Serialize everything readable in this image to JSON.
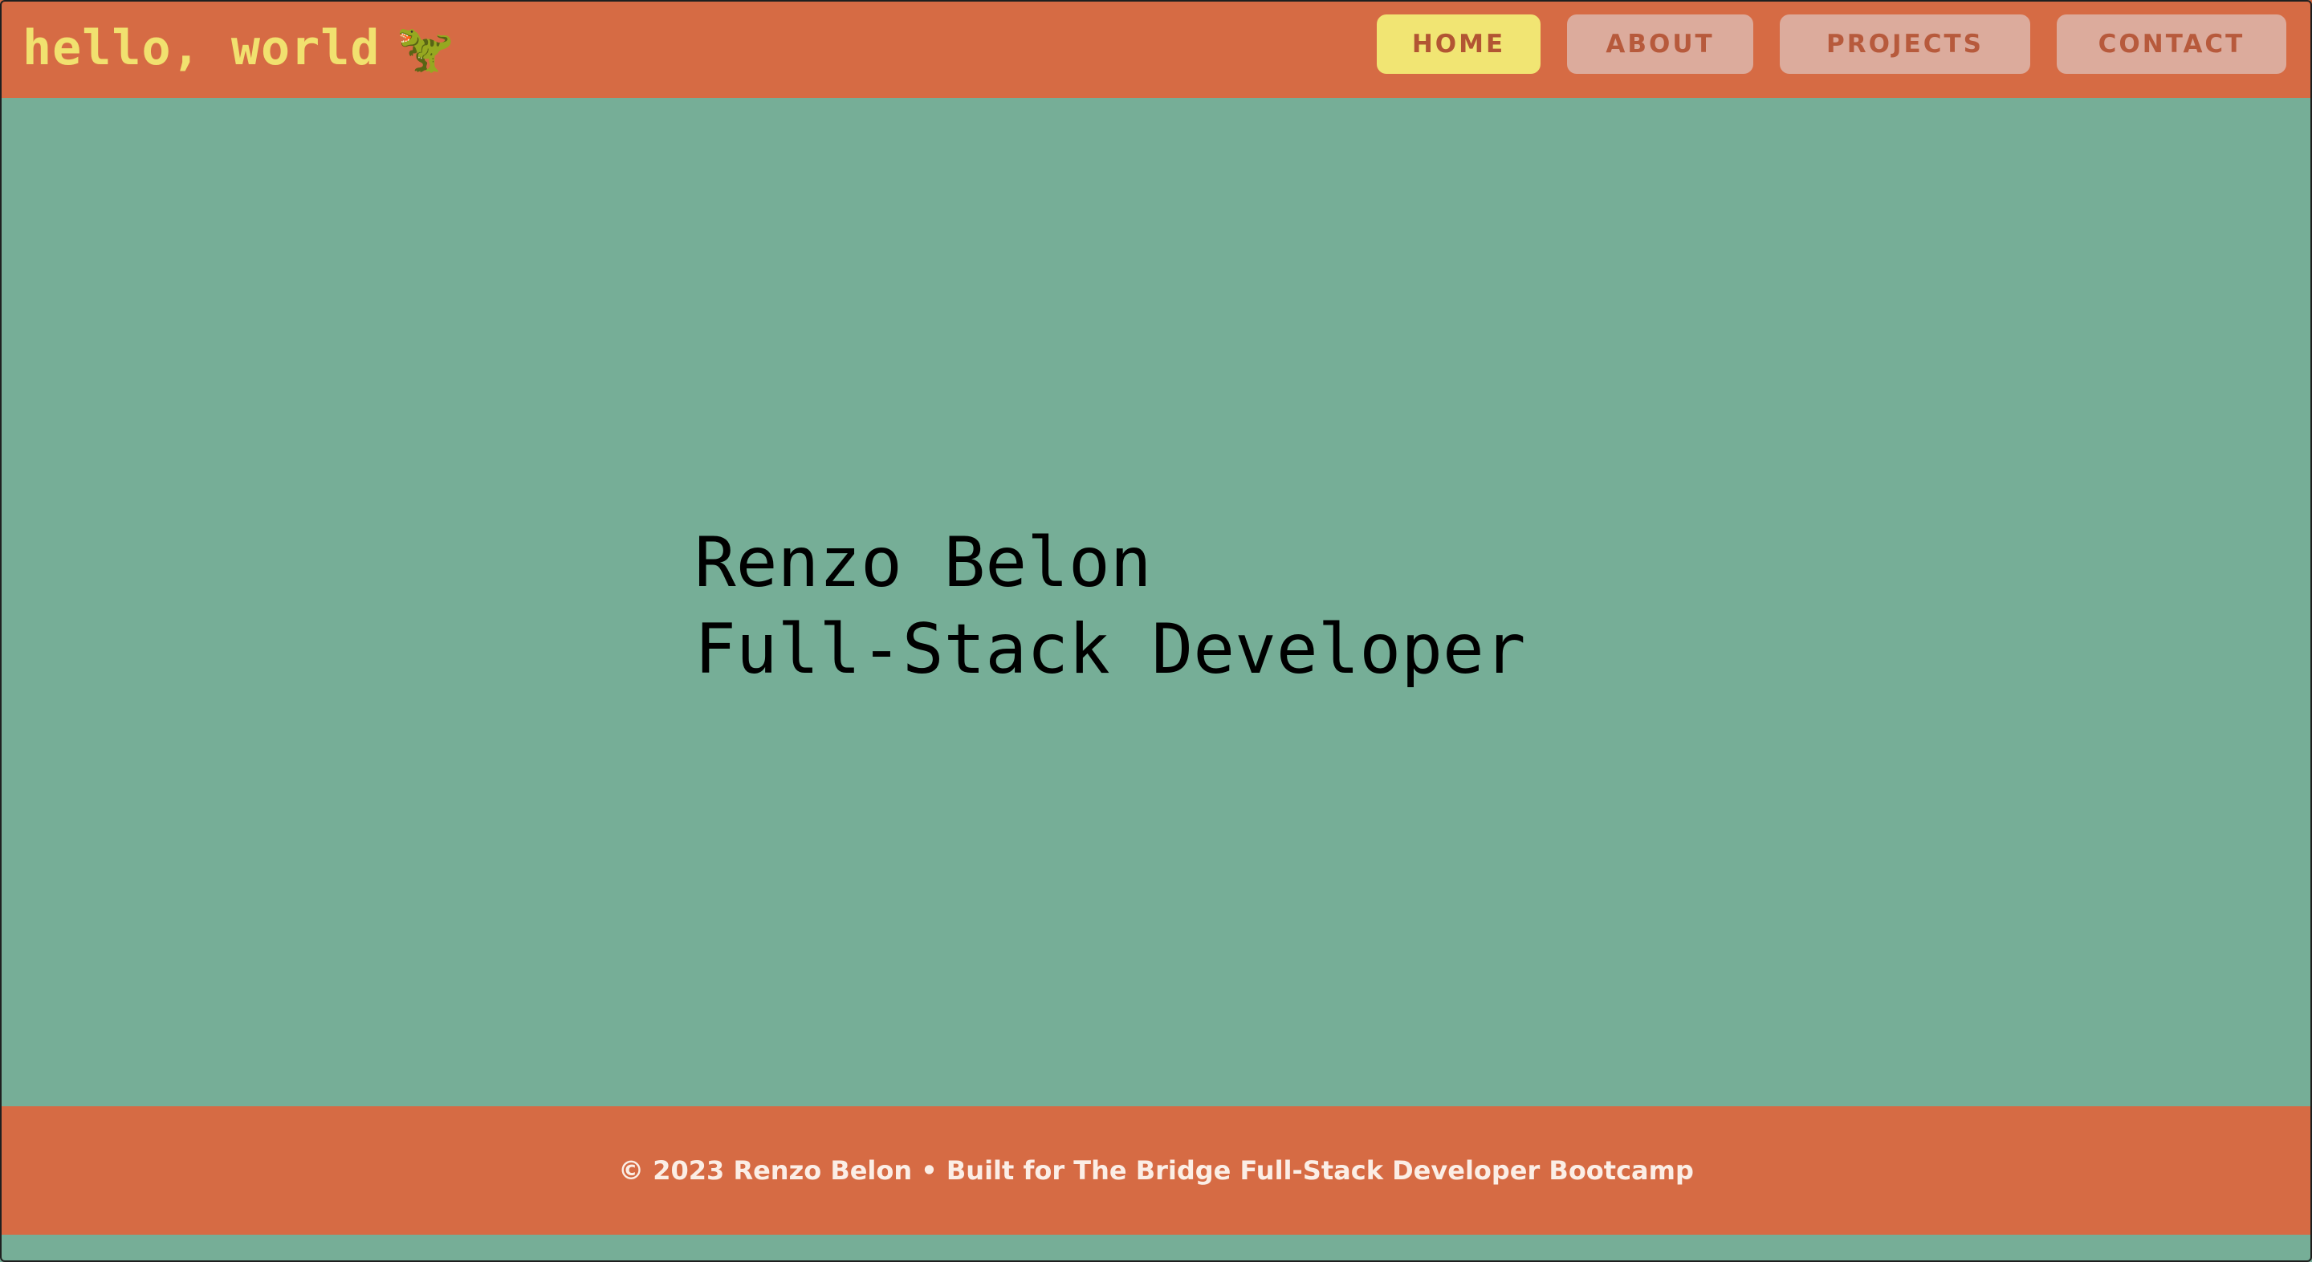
{
  "header": {
    "logo_text": "hello, world",
    "logo_icon": "🦖"
  },
  "nav": {
    "items": [
      {
        "label": "HOME",
        "active": true
      },
      {
        "label": "ABOUT",
        "active": false
      },
      {
        "label": "PROJECTS",
        "active": false
      },
      {
        "label": "CONTACT",
        "active": false
      }
    ]
  },
  "hero": {
    "name": "Renzo Belon",
    "role": "Full-Stack Developer"
  },
  "footer": {
    "text": "© 2023 Renzo Belon • Built for The Bridge Full-Stack Developer Bootcamp"
  },
  "colors": {
    "background": "#76ae97",
    "header_footer": "#d66b44",
    "accent_yellow": "#f1e573",
    "nav_inactive": "#dcab9c"
  },
  "icons": {
    "logo": "dinosaur-icon"
  }
}
